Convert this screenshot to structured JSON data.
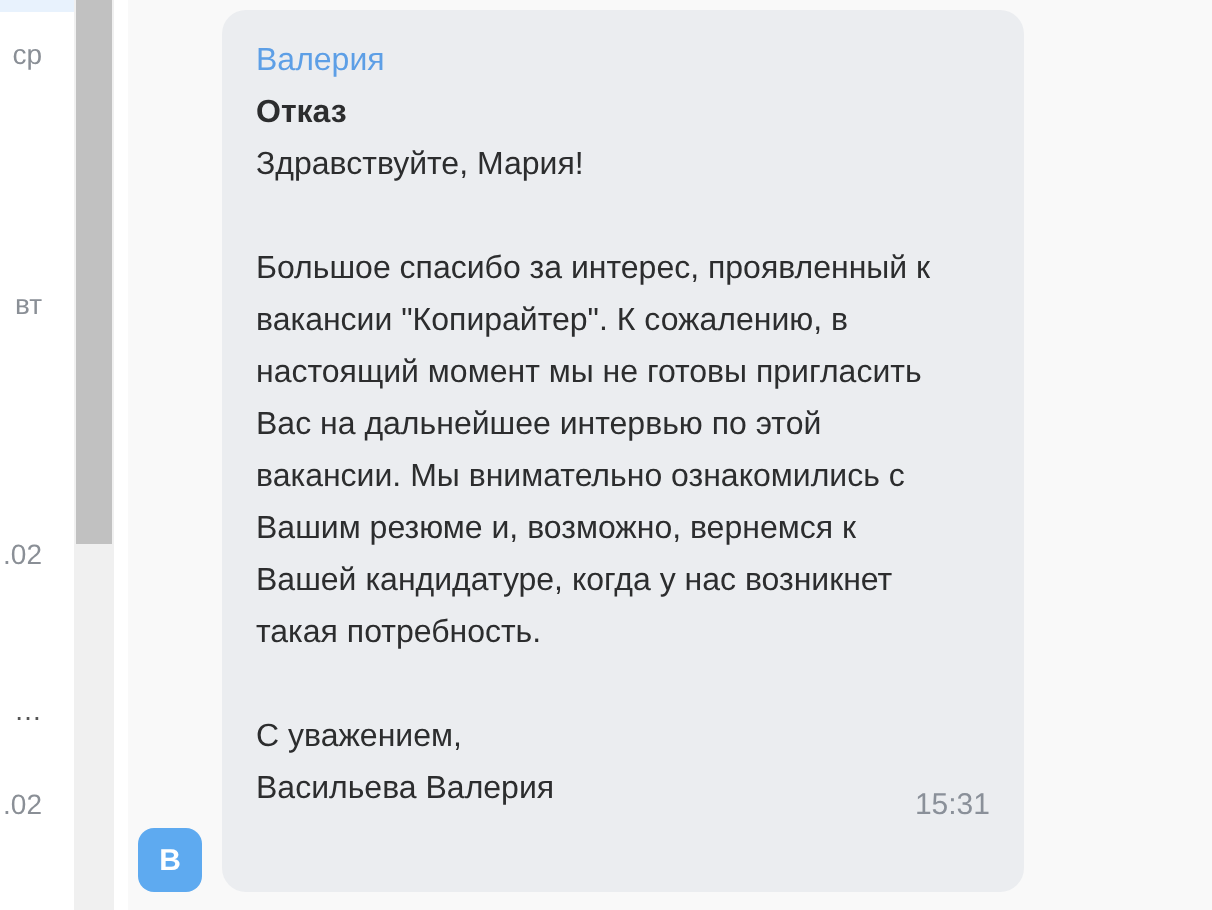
{
  "chat_list": {
    "items": [
      {
        "date": "ср"
      },
      {
        "date": "вт"
      },
      {
        "date": ".02",
        "preview": "…"
      },
      {
        "date": ".02"
      }
    ]
  },
  "message": {
    "sender": "Валерия",
    "subject": "Отказ",
    "greeting": "Здравствуйте, Мария!",
    "body": "Большое спасибо за интерес, проявленный к вакансии \"Копирайтер\". К сожалению, в настоящий момент мы не готовы пригласить Вас на дальнейшее интервью по этой вакансии. Мы внимательно ознакомились с Вашим резюме и, возможно, вернемся к Вашей кандидатуре, когда у нас возникнет такая потребность.",
    "signoff": [
      "С уважением,",
      "Васильева Валерия"
    ],
    "time": "15:31",
    "avatar": "В"
  }
}
